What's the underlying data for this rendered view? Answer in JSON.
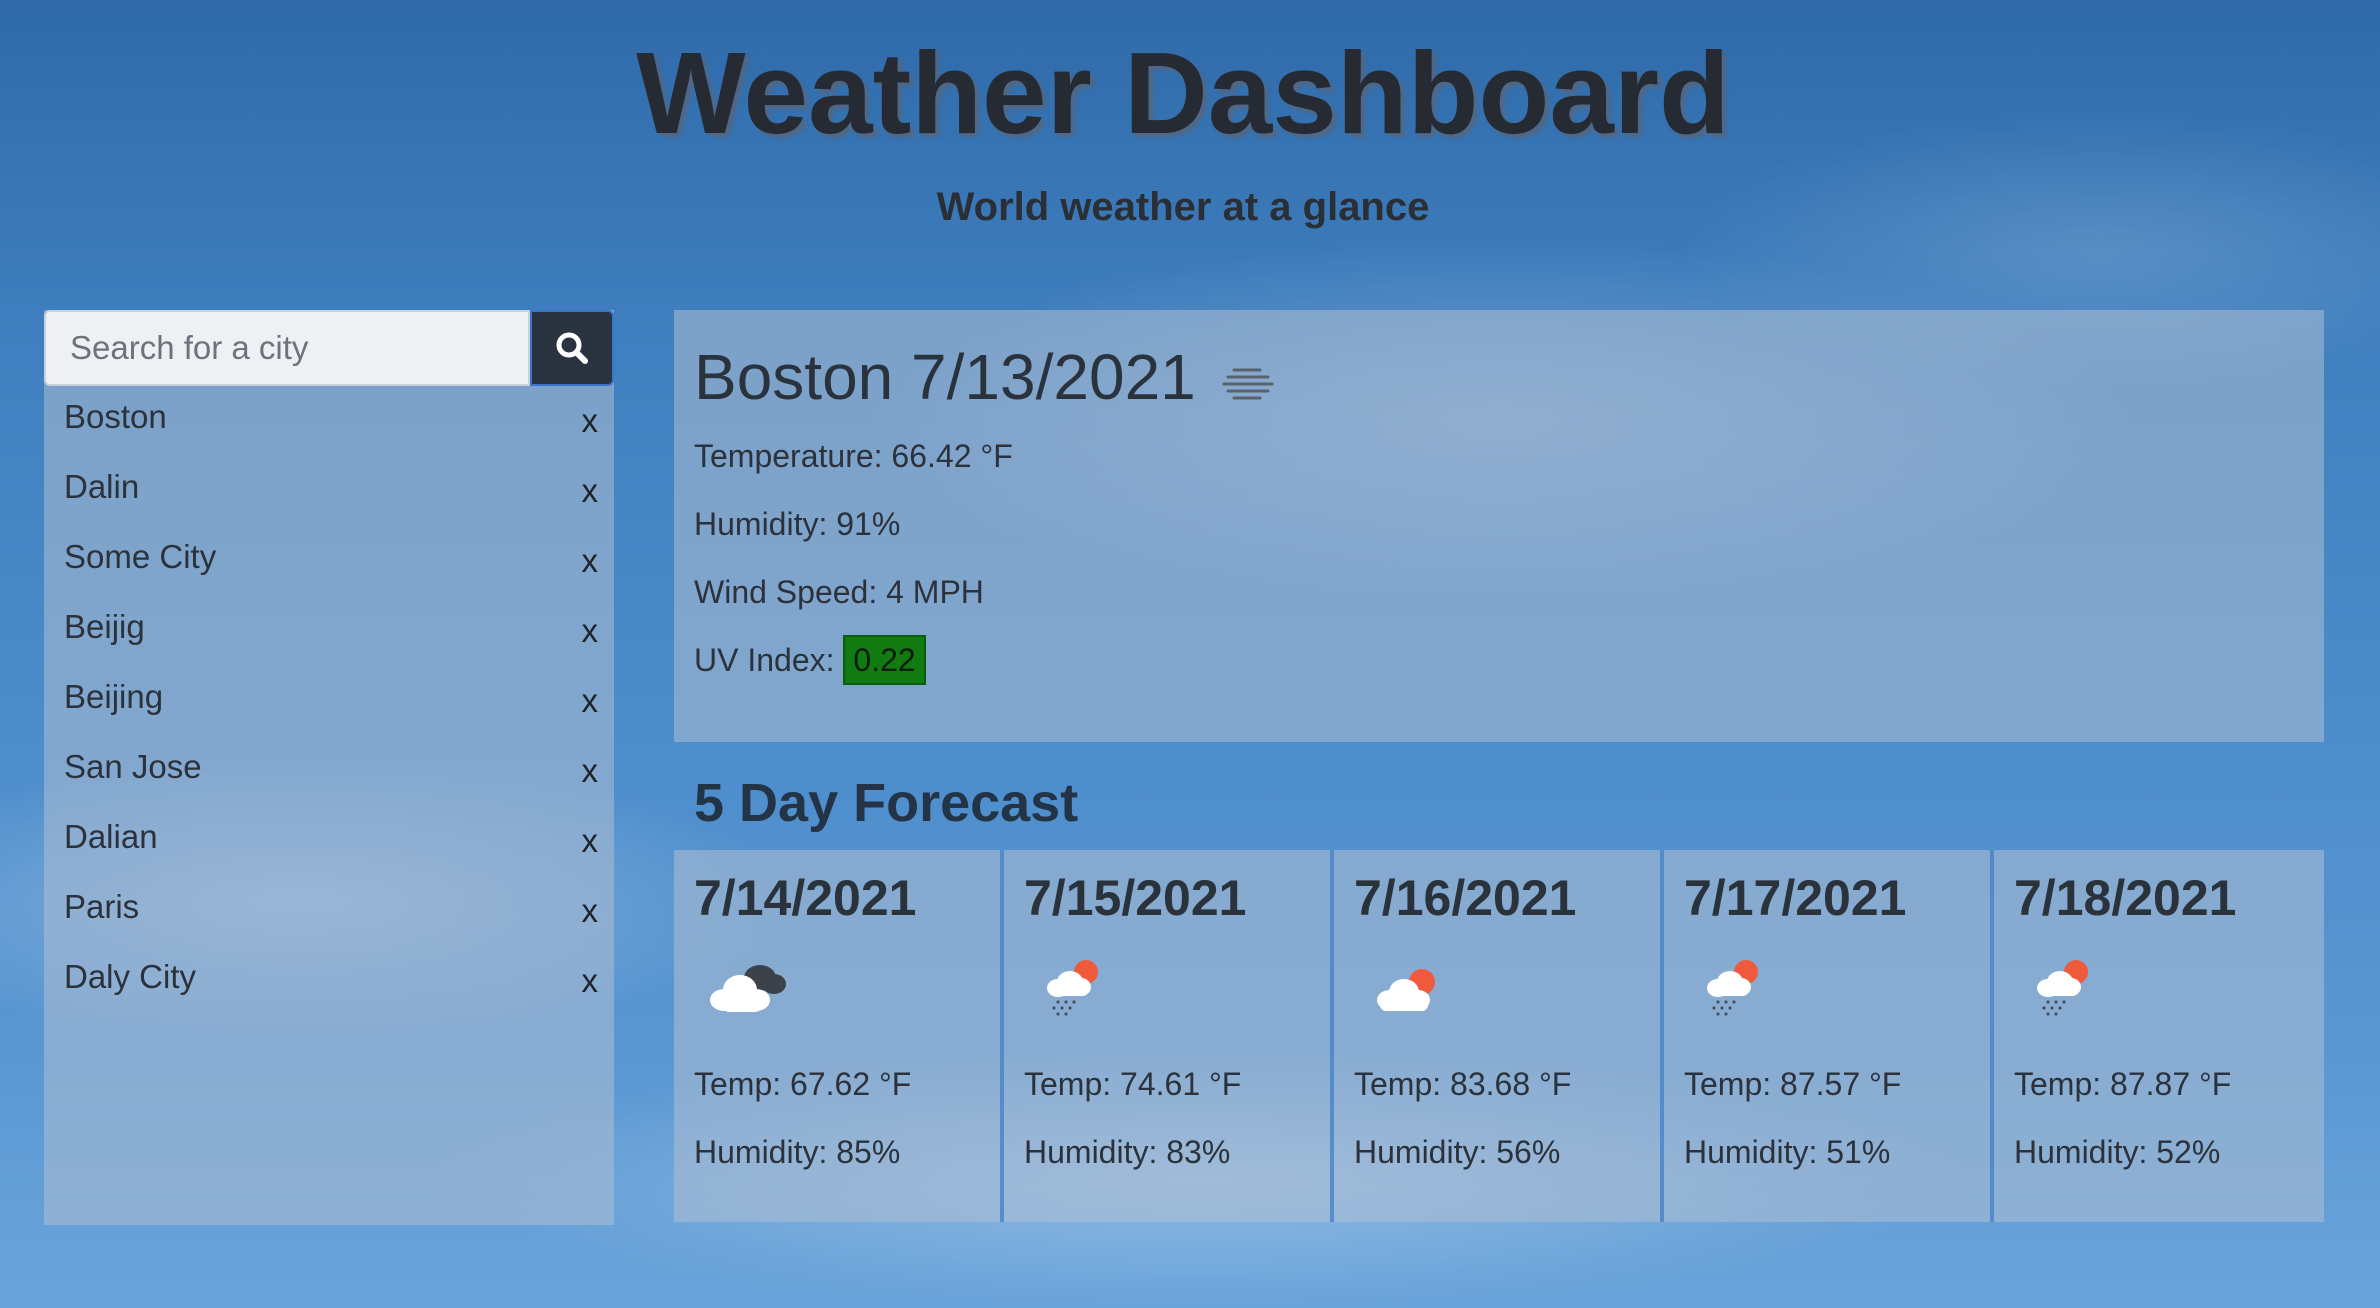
{
  "header": {
    "title": "Weather Dashboard",
    "subtitle": "World weather at a glance"
  },
  "search": {
    "placeholder": "Search for a city",
    "button_icon": "search-icon"
  },
  "history": {
    "remove_label": "x",
    "cities": [
      "Boston",
      "Dalin",
      "Some City",
      "Beijig",
      "Beijing",
      "San Jose",
      "Dalian",
      "Paris",
      "Daly City"
    ]
  },
  "current": {
    "heading": "Boston 7/13/2021",
    "icon": "haze-icon",
    "temperature": "Temperature: 66.42 °F",
    "humidity": "Humidity: 91%",
    "wind": "Wind Speed: 4 MPH",
    "uv_label": "UV Index:",
    "uv_value": "0.22",
    "uv_color": "#117a11"
  },
  "forecast": {
    "title": "5 Day Forecast",
    "days": [
      {
        "date": "7/14/2021",
        "icon": "broken-clouds-icon",
        "temp": "Temp: 67.62 °F",
        "humidity": "Humidity: 85%"
      },
      {
        "date": "7/15/2021",
        "icon": "light-rain-icon",
        "temp": "Temp: 74.61 °F",
        "humidity": "Humidity: 83%"
      },
      {
        "date": "7/16/2021",
        "icon": "few-clouds-icon",
        "temp": "Temp: 83.68 °F",
        "humidity": "Humidity: 56%"
      },
      {
        "date": "7/17/2021",
        "icon": "light-rain-icon",
        "temp": "Temp: 87.57 °F",
        "humidity": "Humidity: 51%"
      },
      {
        "date": "7/18/2021",
        "icon": "light-rain-icon",
        "temp": "Temp: 87.87 °F",
        "humidity": "Humidity: 52%"
      }
    ]
  }
}
